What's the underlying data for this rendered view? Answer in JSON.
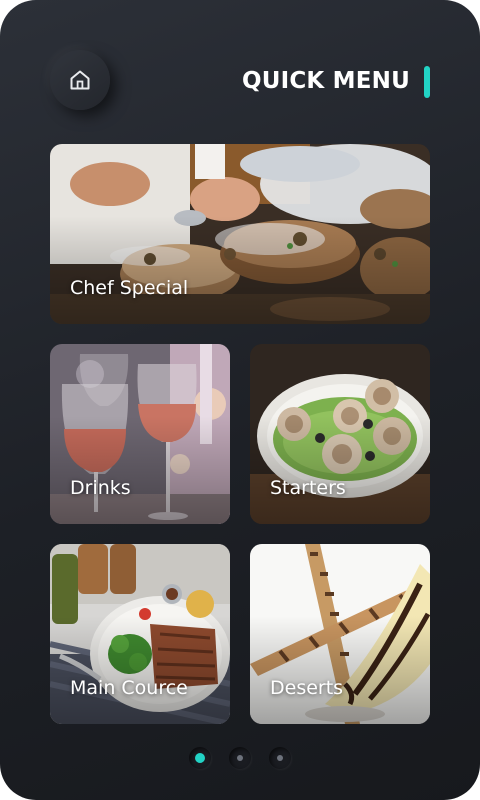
{
  "header": {
    "title": "QUICK MENU",
    "home_icon": "home-icon",
    "accent_color": "#22d3c5"
  },
  "menu": {
    "items": [
      {
        "label": "Chef Special"
      },
      {
        "label": "Drinks"
      },
      {
        "label": "Starters"
      },
      {
        "label": "Main Cource"
      },
      {
        "label": "Deserts"
      }
    ]
  },
  "pager": {
    "pages": 3,
    "active_page": 1,
    "active_color": "#22d3c5"
  }
}
